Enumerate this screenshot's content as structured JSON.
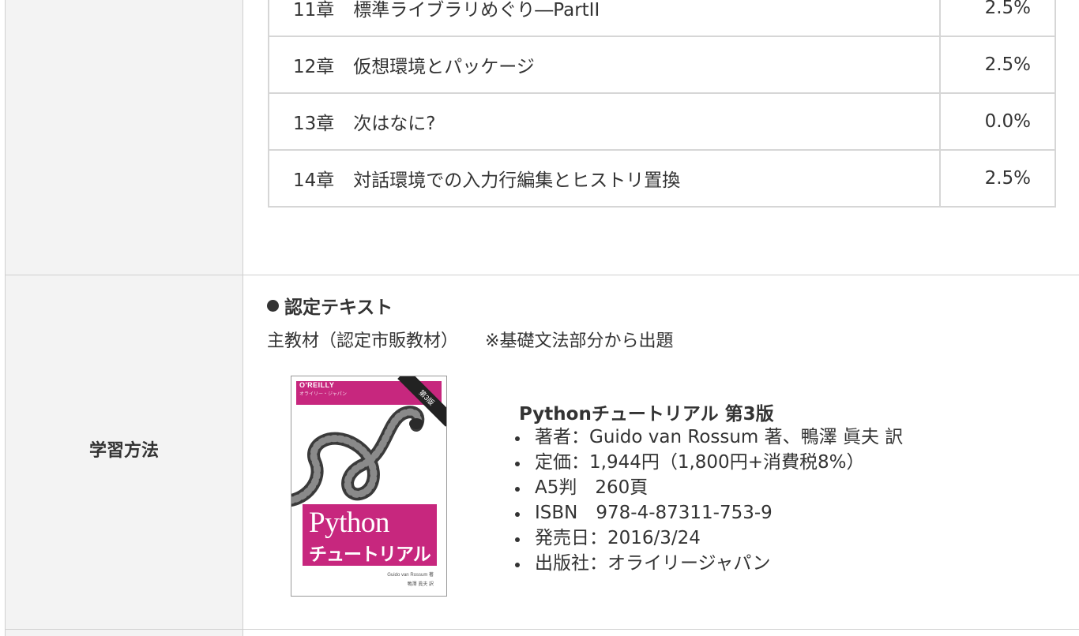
{
  "chapters": [
    {
      "name": "11章",
      "title": "標準ライブラリめぐり―PartII",
      "percent": "2.5%"
    },
    {
      "name": "12章",
      "title": "仮想環境とパッケージ",
      "percent": "2.5%"
    },
    {
      "name": "13章",
      "title": "次はなに?",
      "percent": "0.0%"
    },
    {
      "name": "14章",
      "title": "対話環境での入力行編集とヒストリ置換",
      "percent": "2.5%"
    }
  ],
  "study": {
    "label": "学習方法",
    "section_heading": "認定テキスト",
    "material": "主教材（認定市販教材）",
    "note": "※基礎文法部分から出題"
  },
  "book": {
    "title": "Pythonチュートリアル 第3版",
    "details": [
      "著者：Guido van Rossum 著、鴨澤 眞夫 訳",
      "定価：1,944円（1,800円+消費税8%）",
      "A5判　260頁",
      "ISBN　978-4-87311-753-9",
      "発売日：2016/3/24",
      "出版社：オライリージャパン"
    ],
    "cover": {
      "publisher": "O'REILLY",
      "publisher_sub": "オライリー・ジャパン",
      "edition_badge": "第3版",
      "title_en": "Python",
      "title_jp": "チュートリアル",
      "author": "Guido van Rossum 著",
      "translator": "鴨澤 眞夫 訳",
      "accent_color": "#c7277e"
    }
  }
}
